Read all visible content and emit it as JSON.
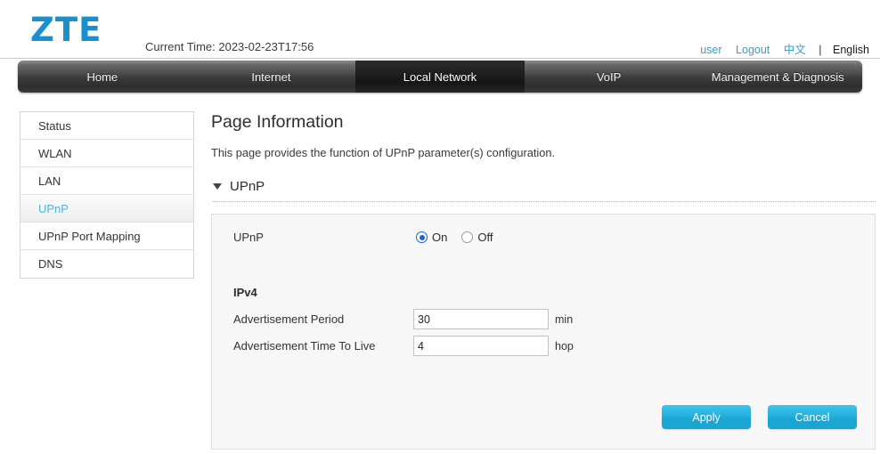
{
  "header": {
    "logo_text": "ZTE",
    "current_time": "Current Time: 2023-02-23T17:56",
    "user_link": "user",
    "logout_link": "Logout",
    "lang_zh": "中文",
    "lang_sep": "|",
    "lang_en": "English",
    "logo_color": "#1a8fd0",
    "link_color": "#3a9bbd"
  },
  "nav": {
    "items": [
      {
        "label": "Home",
        "active": false
      },
      {
        "label": "Internet",
        "active": false
      },
      {
        "label": "Local Network",
        "active": true
      },
      {
        "label": "VoIP",
        "active": false
      },
      {
        "label": "Management & Diagnosis",
        "active": false
      }
    ]
  },
  "sidebar": {
    "items": [
      {
        "label": "Status",
        "active": false
      },
      {
        "label": "WLAN",
        "active": false
      },
      {
        "label": "LAN",
        "active": false
      },
      {
        "label": "UPnP",
        "active": true
      },
      {
        "label": "UPnP Port Mapping",
        "active": false
      },
      {
        "label": "DNS",
        "active": false
      }
    ],
    "active_color": "#4db8d8"
  },
  "main": {
    "page_title": "Page Information",
    "page_desc": "This page provides the function of UPnP parameter(s) configuration.",
    "section": {
      "title": "UPnP",
      "toggle_icon": "triangle-down-icon",
      "expanded": true
    }
  },
  "form": {
    "upnp": {
      "label": "UPnP",
      "options": [
        {
          "label": "On",
          "selected": true
        },
        {
          "label": "Off",
          "selected": false
        }
      ]
    },
    "ipv4_heading": "IPv4",
    "fields": [
      {
        "label": "Advertisement Period",
        "value": "30",
        "placeholder": "",
        "unit": "min"
      },
      {
        "label": "Advertisement Time To Live",
        "value": "4",
        "placeholder": "",
        "unit": "hop"
      }
    ]
  },
  "buttons": {
    "apply": "Apply",
    "cancel": "Cancel",
    "accent_color": "#23b0dd"
  }
}
